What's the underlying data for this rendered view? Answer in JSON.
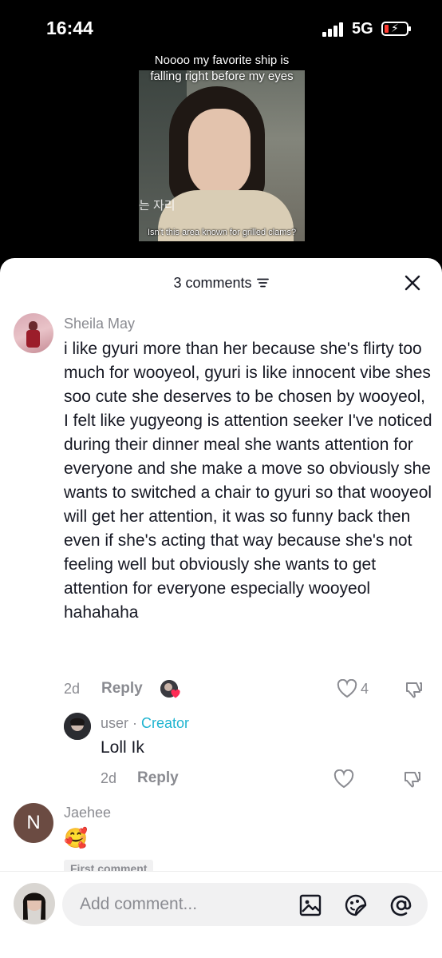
{
  "status_bar": {
    "time": "16:44",
    "network": "5G"
  },
  "video": {
    "caption": "Noooo my favorite ship is falling right before my eyes",
    "korean_text": "는 자리",
    "subtitle": "Isn't this area known for grilled clams?"
  },
  "sheet": {
    "comment_count": "3 comments"
  },
  "comments": [
    {
      "author": "Sheila May",
      "text": "i like gyuri more than her because she's flirty too much for wooyeol, gyuri is like innocent vibe shes soo cute she deserves to be chosen by wooyeol, I felt like yugyeong is attention seeker I've noticed during their dinner meal she wants attention for everyone and she make a move so obviously she wants to switched a chair to gyuri so that wooyeol will get her attention, it was so funny back then even if she's acting that way because she's not feeling well but obviously she wants to get attention for everyone especially wooyeol hahahaha",
      "time": "2d",
      "reply_label": "Reply",
      "likes": "4"
    },
    {
      "author": "user",
      "separator": " · ",
      "badge": "Creator",
      "text": "Loll Ik",
      "time": "2d",
      "reply_label": "Reply"
    },
    {
      "author": "Jaehee",
      "avatar_letter": "N",
      "text": "🥰",
      "tag": "First comment"
    }
  ],
  "composer": {
    "placeholder": "Add comment..."
  },
  "colors": {
    "accent_creator": "#20b4d0",
    "text_primary": "#161823",
    "text_secondary": "#8a8b91",
    "like_badge": "#fe2c55"
  },
  "icons": [
    "sort-icon",
    "close-icon",
    "heart-icon",
    "dislike-icon",
    "image-icon",
    "sticker-icon",
    "mention-icon"
  ]
}
